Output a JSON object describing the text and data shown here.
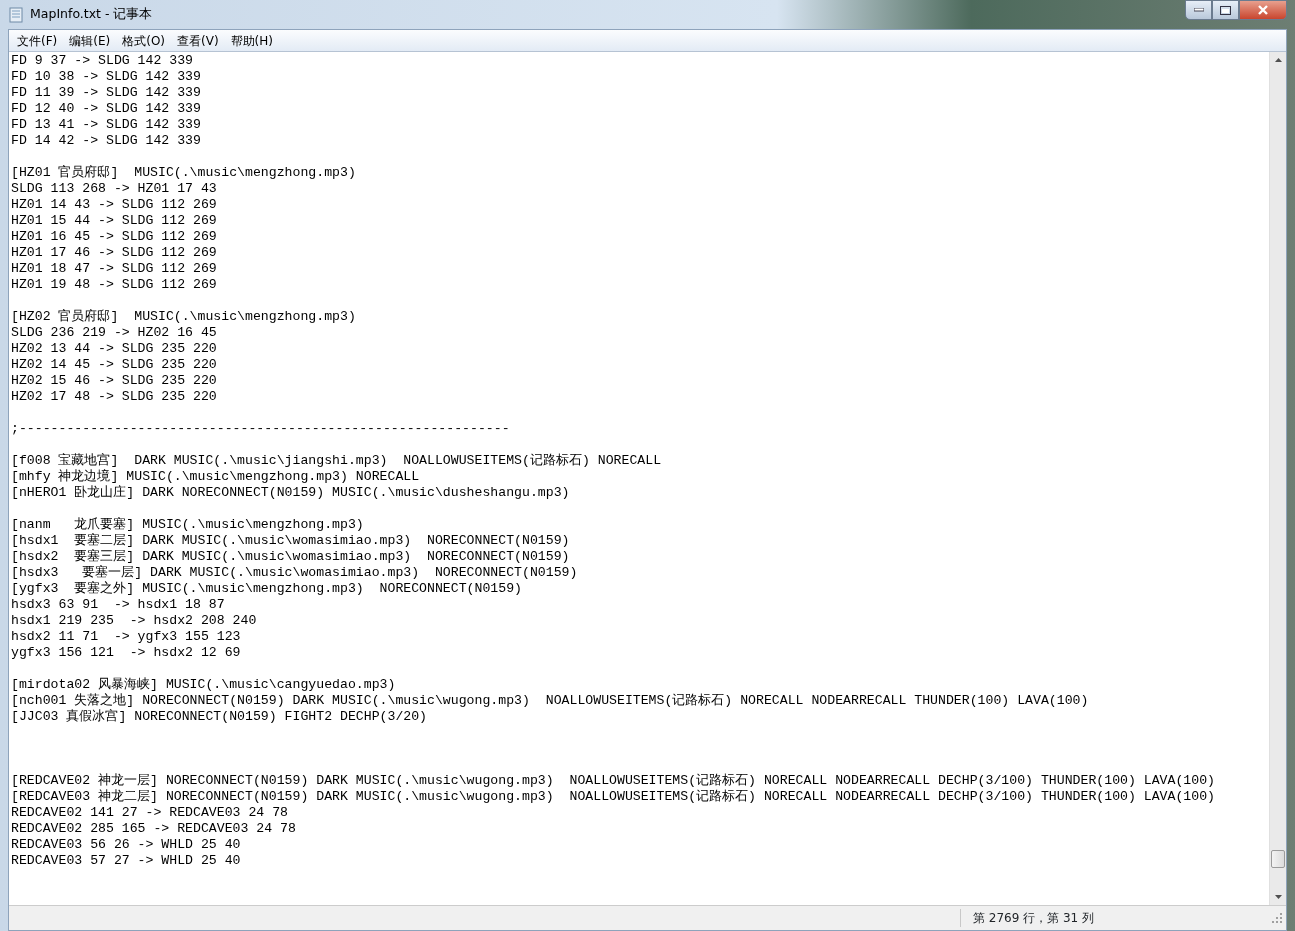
{
  "window": {
    "title": "MapInfo.txt - 记事本"
  },
  "menu": [
    "文件(F)",
    "编辑(E)",
    "格式(O)",
    "查看(V)",
    "帮助(H)"
  ],
  "editor": {
    "lines": [
      {
        "kind": "text",
        "text": "FD 9 37 -> SLDG 142 339"
      },
      {
        "kind": "text",
        "text": "FD 10 38 -> SLDG 142 339"
      },
      {
        "kind": "text",
        "text": "FD 11 39 -> SLDG 142 339"
      },
      {
        "kind": "text",
        "text": "FD 12 40 -> SLDG 142 339"
      },
      {
        "kind": "text",
        "text": "FD 13 41 -> SLDG 142 339"
      },
      {
        "kind": "text",
        "text": "FD 14 42 -> SLDG 142 339"
      },
      {
        "kind": "blank"
      },
      {
        "kind": "text",
        "text": "[HZ01 官员府邸]  MUSIC(.\\music\\mengzhong.mp3)"
      },
      {
        "kind": "text",
        "text": "SLDG 113 268 -> HZ01 17 43"
      },
      {
        "kind": "text",
        "text": "HZ01 14 43 -> SLDG 112 269"
      },
      {
        "kind": "text",
        "text": "HZ01 15 44 -> SLDG 112 269"
      },
      {
        "kind": "text",
        "text": "HZ01 16 45 -> SLDG 112 269"
      },
      {
        "kind": "text",
        "text": "HZ01 17 46 -> SLDG 112 269"
      },
      {
        "kind": "text",
        "text": "HZ01 18 47 -> SLDG 112 269"
      },
      {
        "kind": "text",
        "text": "HZ01 19 48 -> SLDG 112 269"
      },
      {
        "kind": "blank"
      },
      {
        "kind": "text",
        "text": "[HZ02 官员府邸]  MUSIC(.\\music\\mengzhong.mp3)"
      },
      {
        "kind": "text",
        "text": "SLDG 236 219 -> HZ02 16 45"
      },
      {
        "kind": "text",
        "text": "HZ02 13 44 -> SLDG 235 220"
      },
      {
        "kind": "text",
        "text": "HZ02 14 45 -> SLDG 235 220"
      },
      {
        "kind": "text",
        "text": "HZ02 15 46 -> SLDG 235 220"
      },
      {
        "kind": "text",
        "text": "HZ02 17 48 -> SLDG 235 220"
      },
      {
        "kind": "blank"
      },
      {
        "kind": "text",
        "text": ";--------------------------------------------------------------"
      },
      {
        "kind": "blank"
      },
      {
        "kind": "text",
        "text": "[f008 宝藏地宫]  DARK MUSIC(.\\music\\jiangshi.mp3)  NOALLOWUSEITEMS(记路标石) NORECALL"
      },
      {
        "kind": "text",
        "text": "[mhfy 神龙边境] MUSIC(.\\music\\mengzhong.mp3) NORECALL"
      },
      {
        "kind": "text",
        "text": "[nHERO1 卧龙山庄] DARK NORECONNECT(N0159) MUSIC(.\\music\\dusheshangu.mp3)"
      },
      {
        "kind": "blank"
      },
      {
        "kind": "text",
        "text": "[nanm   龙爪要塞] MUSIC(.\\music\\mengzhong.mp3)"
      },
      {
        "kind": "text",
        "text": "[hsdx1  要塞二层] DARK MUSIC(.\\music\\womasimiao.mp3)  NORECONNECT(N0159)"
      },
      {
        "kind": "text",
        "text": "[hsdx2  要塞三层] DARK MUSIC(.\\music\\womasimiao.mp3)  NORECONNECT(N0159)"
      },
      {
        "kind": "text",
        "text": "[hsdx3   要塞一层] DARK MUSIC(.\\music\\womasimiao.mp3)  NORECONNECT(N0159)"
      },
      {
        "kind": "text",
        "text": "[ygfx3  要塞之外] MUSIC(.\\music\\mengzhong.mp3)  NORECONNECT(N0159)"
      },
      {
        "kind": "text",
        "text": "hsdx3 63 91  -> hsdx1 18 87"
      },
      {
        "kind": "text",
        "text": "hsdx1 219 235  -> hsdx2 208 240"
      },
      {
        "kind": "text",
        "text": "hsdx2 11 71  -> ygfx3 155 123"
      },
      {
        "kind": "text",
        "text": "ygfx3 156 121  -> hsdx2 12 69"
      },
      {
        "kind": "blank"
      },
      {
        "kind": "text",
        "text": "[mirdota02 风暴海峡] MUSIC(.\\music\\cangyuedao.mp3)"
      },
      {
        "kind": "text",
        "text": "[nch001 失落之地] NORECONNECT(N0159) DARK MUSIC(.\\music\\wugong.mp3)  NOALLOWUSEITEMS(记路标石) NORECALL NODEARRECALL THUNDER(100) LAVA(100)"
      },
      {
        "kind": "text",
        "text": "[JJC03 真假冰宫] NORECONNECT(N0159) FIGHT2 DECHP(3/20)"
      },
      {
        "kind": "blank"
      },
      {
        "kind": "blank"
      },
      {
        "kind": "blank"
      },
      {
        "kind": "text",
        "text": "[REDCAVE02 神龙一层] NORECONNECT(N0159) DARK MUSIC(.\\music\\wugong.mp3)  NOALLOWUSEITEMS(记路标石) NORECALL NODEARRECALL DECHP(3/100) THUNDER(100) LAVA(100)"
      },
      {
        "kind": "text",
        "text": "[REDCAVE03 神龙二层] NORECONNECT(N0159) DARK MUSIC(.\\music\\wugong.mp3)  NOALLOWUSEITEMS(记路标石) NORECALL NODEARRECALL DECHP(3/100) THUNDER(100) LAVA(100)"
      },
      {
        "kind": "text",
        "text": "REDCAVE02 141 27 -> REDCAVE03 24 78"
      },
      {
        "kind": "text",
        "text": "REDCAVE02 285 165 -> REDCAVE03 24 78"
      },
      {
        "kind": "text",
        "text": "REDCAVE03 56 26 -> WHLD 25 40"
      },
      {
        "kind": "text",
        "text": "REDCAVE03 57 27 -> WHLD 25 40"
      }
    ]
  },
  "status_bar": {
    "position": "第 2769 行，第 31 列"
  }
}
